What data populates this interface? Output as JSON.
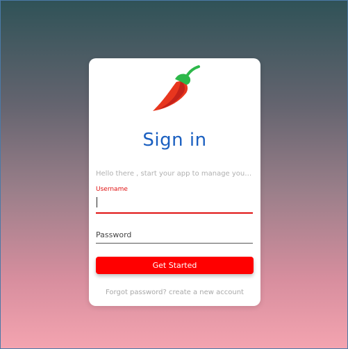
{
  "login": {
    "title": "Sign in",
    "subtitle": "Hello there , start your app to manage your s...",
    "username_label": "Username",
    "username_value": "",
    "password_placeholder": "Password",
    "button_label": "Get Started",
    "forgot_link": "Forgot password?",
    "create_link": "create a new account"
  },
  "icons": {
    "logo": "chili-pepper-icon"
  },
  "colors": {
    "accent": "#ff0000",
    "title": "#1a5fc0",
    "pepper_body": "#e8361e",
    "pepper_stem": "#2db84a"
  }
}
